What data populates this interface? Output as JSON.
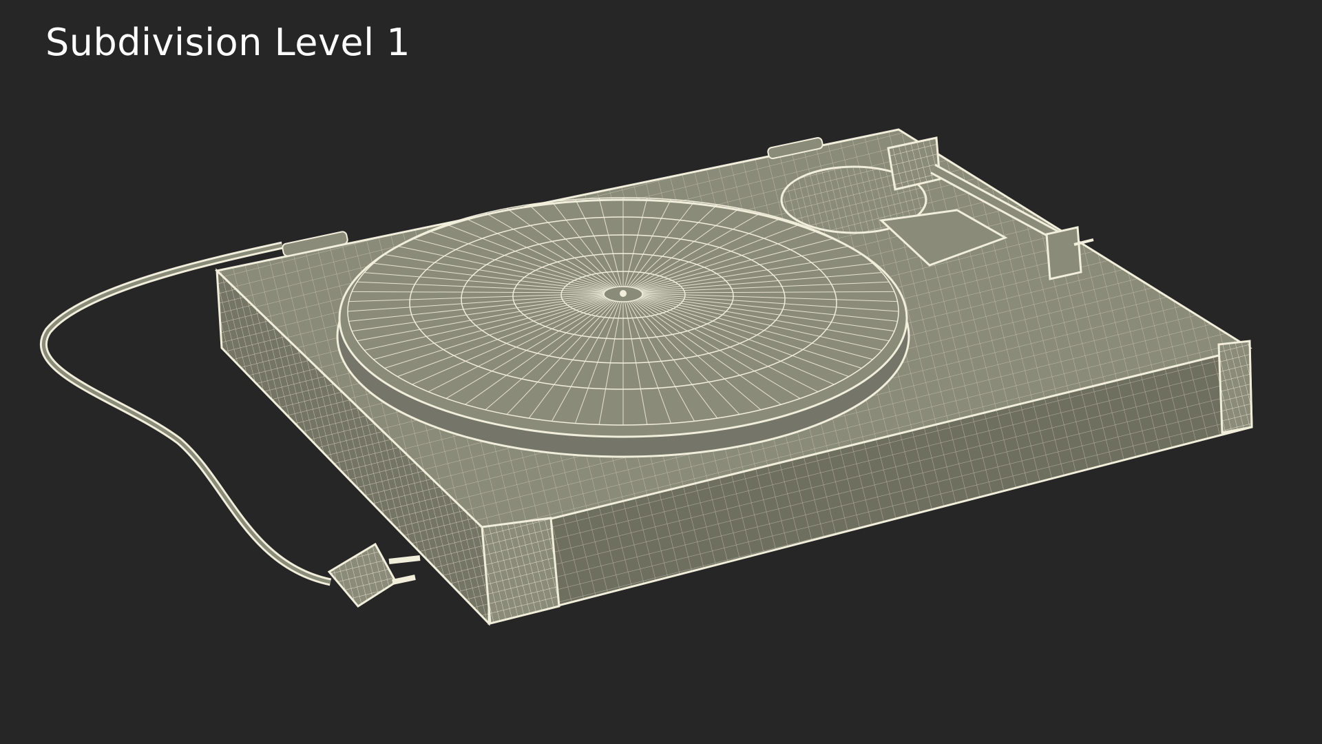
{
  "title": "Subdivision Level 1",
  "colors": {
    "background": "#262626",
    "mesh_fill": "#8b8b7a",
    "mesh_fill_dark": "#6f6f60",
    "wire": "#f1eedc"
  },
  "scene": {
    "object": "turntable-wireframe",
    "parts": [
      "base",
      "platter",
      "tonearm",
      "power-cord",
      "plug"
    ]
  }
}
